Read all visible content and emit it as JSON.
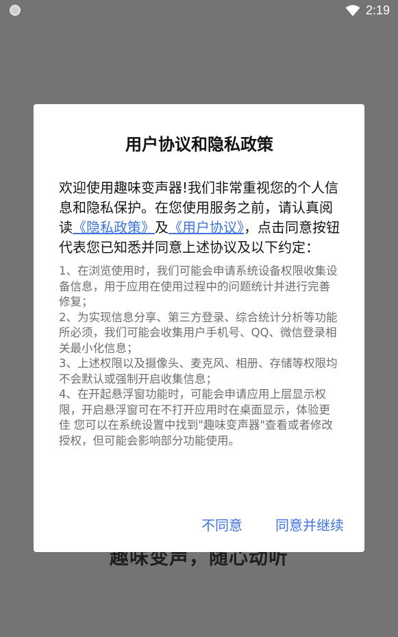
{
  "status_bar": {
    "time": "2:19"
  },
  "background": {
    "slogan": "趣味变声，随心动听"
  },
  "dialog": {
    "title": "用户协议和隐私政策",
    "intro": {
      "part1": "欢迎使用趣味变声器!我们非常重视您的个人信息和隐私保护。在您使用服务之前，请认真阅读",
      "privacy_link": "《隐私政策》",
      "and": "及",
      "agreement_link": "《用户协议》",
      "part2": "，点击同意按钮代表您已知悉并同意上述协议及以下约定："
    },
    "details": [
      "1、在浏览使用时，我们可能会申请系统设备权限收集设备信息，用于应用在使用过程中的问题统计并进行完善修复；",
      " 2、为实现信息分享、第三方登录、综合统计分析等功能所必须，我们可能会收集用户手机号、QQ、微信登录相关最小化信息；",
      " 3、上述权限以及摄像头、麦克风、相册、存储等权限均不会默认或强制开启收集信息；",
      " 4、在开起悬浮窗功能时，可能会申请应用上层显示权限，开启悬浮窗可在不打开应用时在桌面显示，体验更佳 您可以在系统设置中找到\"趣味变声器\"查看或者修改授权，但可能会影响部分功能使用。"
    ],
    "disagree_label": "不同意",
    "agree_label": "同意并继续"
  }
}
